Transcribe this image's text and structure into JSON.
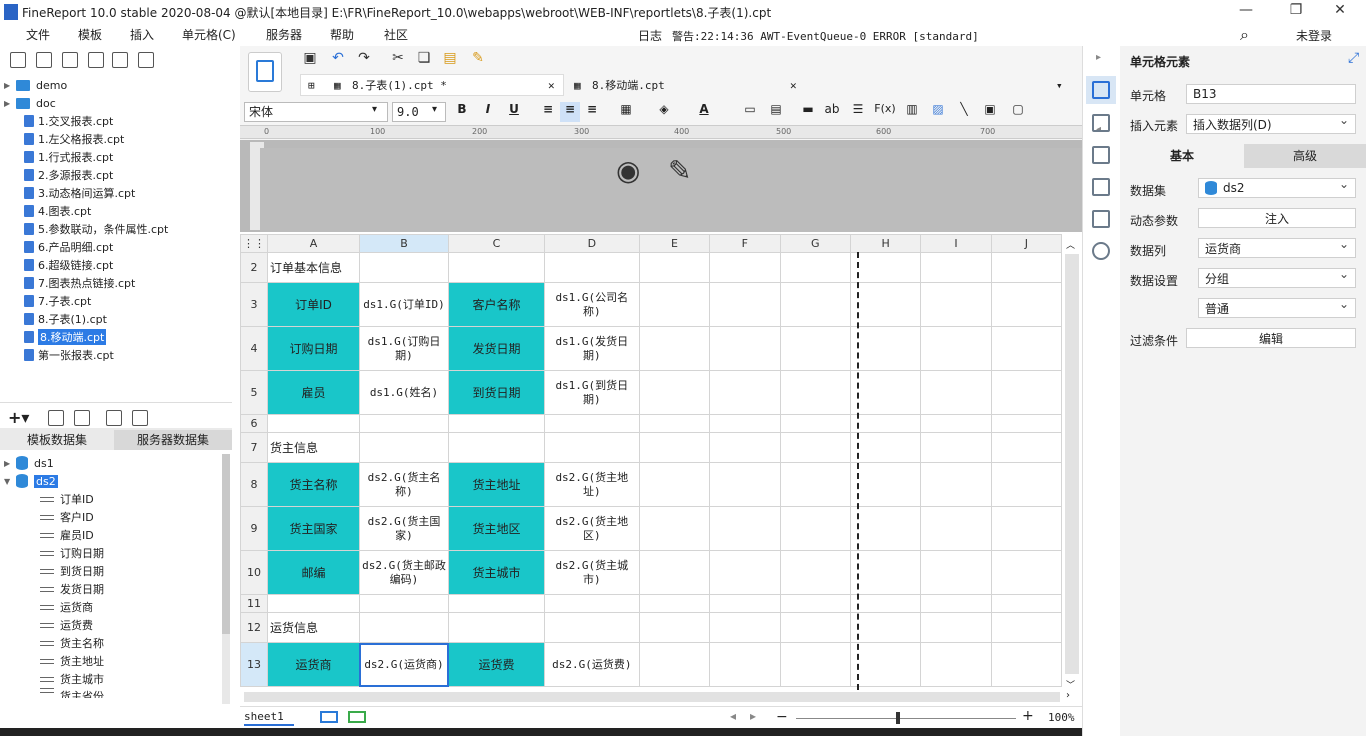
{
  "window": {
    "title": "FineReport 10.0 stable 2020-08-04 @默认[本地目录]    E:\\FR\\FineReport_10.0\\webapps\\webroot\\WEB-INF\\reportlets\\8.子表(1).cpt",
    "controls": [
      "—",
      "❐",
      "✕"
    ]
  },
  "menu": {
    "items": [
      "文件",
      "模板",
      "插入",
      "单元格(C)",
      "服务器",
      "帮助",
      "社区"
    ],
    "log_label": "日志",
    "alert": "警告:22:14:36 AWT-EventQueue-0 ERROR [standard]",
    "login": "未登录"
  },
  "tree": {
    "folders": [
      "demo",
      "doc"
    ],
    "files": [
      "1.交叉报表.cpt",
      "1.左父格报表.cpt",
      "1.行式报表.cpt",
      "2.多源报表.cpt",
      "3.动态格间运算.cpt",
      "4.图表.cpt",
      "5.参数联动，条件属性.cpt",
      "6.产品明细.cpt",
      "6.超级链接.cpt",
      "7.图表热点链接.cpt",
      "7.子表.cpt",
      "8.子表(1).cpt",
      "8.移动端.cpt",
      "第一张报表.cpt"
    ],
    "selected": "8.移动端.cpt"
  },
  "datasets": {
    "tab_template": "模板数据集",
    "tab_server": "服务器数据集",
    "ds1": "ds1",
    "ds2": "ds2",
    "fields": [
      "订单ID",
      "客户ID",
      "雇员ID",
      "订购日期",
      "到货日期",
      "发货日期",
      "运货商",
      "运货费",
      "货主名称",
      "货主地址",
      "货主城市",
      "货主省份"
    ]
  },
  "tabs": [
    {
      "label": "8.子表(1).cpt *"
    },
    {
      "label": "8.移动端.cpt"
    }
  ],
  "format": {
    "font": "宋体",
    "size": "9.0",
    "bold": "B",
    "italic": "I",
    "underline": "U",
    "text_a": "A",
    "ab": "ab",
    "fx": "F(x)"
  },
  "ruler": [
    "0",
    "100",
    "200",
    "300",
    "400",
    "500",
    "600",
    "700"
  ],
  "columns": [
    "A",
    "B",
    "C",
    "D",
    "E",
    "F",
    "G",
    "H",
    "I",
    "J"
  ],
  "rows": {
    "r2": {
      "num": "2",
      "a": "订单基本信息"
    },
    "r3": {
      "num": "3",
      "a": "订单ID",
      "b": "ds1.G(订单ID)",
      "c": "客户名称",
      "d": "ds1.G(公司名称)"
    },
    "r4": {
      "num": "4",
      "a": "订购日期",
      "b": "ds1.G(订购日期)",
      "c": "发货日期",
      "d": "ds1.G(发货日期)"
    },
    "r5": {
      "num": "5",
      "a": "雇员",
      "b": "ds1.G(姓名)",
      "c": "到货日期",
      "d": "ds1.G(到货日期)"
    },
    "r6": {
      "num": "6"
    },
    "r7": {
      "num": "7",
      "a": "货主信息"
    },
    "r8": {
      "num": "8",
      "a": "货主名称",
      "b": "ds2.G(货主名称)",
      "c": "货主地址",
      "d": "ds2.G(货主地址)"
    },
    "r9": {
      "num": "9",
      "a": "货主国家",
      "b": "ds2.G(货主国家)",
      "c": "货主地区",
      "d": "ds2.G(货主地区)"
    },
    "r10": {
      "num": "10",
      "a": "邮编",
      "b": "ds2.G(货主邮政编码)",
      "c": "货主城市",
      "d": "ds2.G(货主城市)"
    },
    "r11": {
      "num": "11"
    },
    "r12": {
      "num": "12",
      "a": "运货信息"
    },
    "r13": {
      "num": "13",
      "a": "运货商",
      "b": "ds2.G(运货商)",
      "c": "运货费",
      "d": "ds2.G(运货费)"
    }
  },
  "sheet": {
    "name": "sheet1",
    "zoom": "100%"
  },
  "right": {
    "title": "单元格元素",
    "cell_label": "单元格",
    "cell_value": "B13",
    "insert_label": "插入元素",
    "insert_value": "插入数据列(D)",
    "tab_basic": "基本",
    "tab_advanced": "高级",
    "dataset_label": "数据集",
    "dataset_value": "ds2",
    "param_label": "动态参数",
    "param_button": "注入",
    "column_label": "数据列",
    "column_value": "运货商",
    "setting_label": "数据设置",
    "setting_value": "分组",
    "setting_value2": "普通",
    "filter_label": "过滤条件",
    "filter_button": "编辑"
  },
  "colors": {
    "teal": "#19c6c9",
    "accent": "#2c7be5"
  }
}
